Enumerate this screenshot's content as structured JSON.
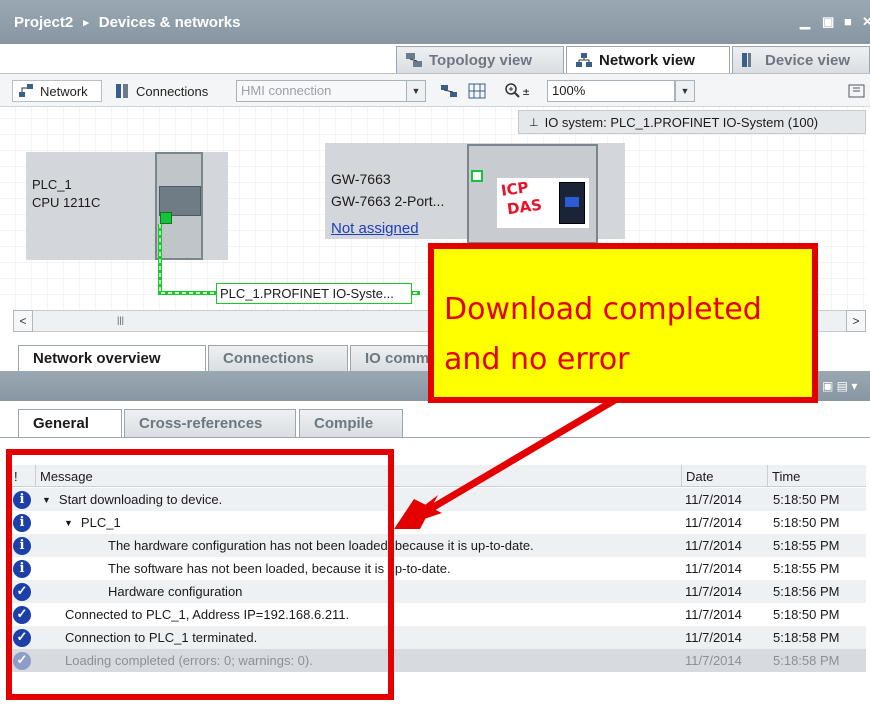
{
  "title_bar": {
    "project": "Project2",
    "separator": "▸",
    "location": "Devices & networks"
  },
  "view_tabs": [
    {
      "label": "Topology view",
      "active": false
    },
    {
      "label": "Network view",
      "active": true
    },
    {
      "label": "Device view",
      "active": false
    }
  ],
  "toolbar": {
    "network_label": "Network",
    "connections_label": "Connections",
    "connection_type_value": "HMI connection",
    "zoom_value": "100%"
  },
  "canvas": {
    "io_system_label": "IO system: PLC_1.PROFINET IO-System (100)",
    "plc": {
      "name": "PLC_1",
      "cpu": "CPU 1211C"
    },
    "gateway": {
      "name": "GW-7663",
      "type": "GW-7663  2-Port...",
      "assignment": "Not assigned",
      "logo_lines": [
        "ICP",
        "DAS"
      ]
    },
    "network_label": "PLC_1.PROFINET IO-Syste..."
  },
  "overview_tabs": [
    {
      "label": "Network overview",
      "active": true
    },
    {
      "label": "Connections",
      "active": false
    },
    {
      "label": "IO comm",
      "active": false
    }
  ],
  "inspector_tabs": [
    {
      "label": "General",
      "active": true
    },
    {
      "label": "Cross-references",
      "active": false
    },
    {
      "label": "Compile",
      "active": false
    }
  ],
  "messages": {
    "columns": {
      "flag": "!",
      "message": "Message",
      "date": "Date",
      "time": "Time"
    },
    "rows": [
      {
        "status": "info",
        "indent": 0,
        "expander": true,
        "text": "Start downloading to device.",
        "date": "11/7/2014",
        "time": "5:18:50 PM"
      },
      {
        "status": "info",
        "indent": 1,
        "expander": true,
        "text": "PLC_1",
        "date": "11/7/2014",
        "time": "5:18:50 PM"
      },
      {
        "status": "info",
        "indent": 2,
        "expander": false,
        "text": "The hardware configuration has not been loaded, because it is up-to-date.",
        "date": "11/7/2014",
        "time": "5:18:55 PM"
      },
      {
        "status": "info",
        "indent": 2,
        "expander": false,
        "text": "The software has not been loaded, because it is up-to-date.",
        "date": "11/7/2014",
        "time": "5:18:55 PM"
      },
      {
        "status": "ok",
        "indent": 2,
        "expander": false,
        "text": "Hardware configuration",
        "date": "11/7/2014",
        "time": "5:18:56 PM"
      },
      {
        "status": "ok",
        "indent": 0,
        "expander": false,
        "text": "Connected to PLC_1, Address IP=192.168.6.211.",
        "date": "11/7/2014",
        "time": "5:18:50 PM"
      },
      {
        "status": "ok",
        "indent": 0,
        "expander": false,
        "text": "Connection to PLC_1 terminated.",
        "date": "11/7/2014",
        "time": "5:18:58 PM"
      },
      {
        "status": "ok",
        "indent": 0,
        "expander": false,
        "text": "Loading completed (errors: 0; warnings: 0).",
        "date": "11/7/2014",
        "time": "5:18:58 PM"
      }
    ]
  },
  "annotation": {
    "lines": [
      "Download completed",
      "and no error"
    ],
    "color": "#e50000",
    "background": "#ffff00"
  },
  "colors": {
    "title_bar": "#8f9eaa",
    "info_icon": "#1d3fa8",
    "profinet_line": "#19c82a"
  }
}
